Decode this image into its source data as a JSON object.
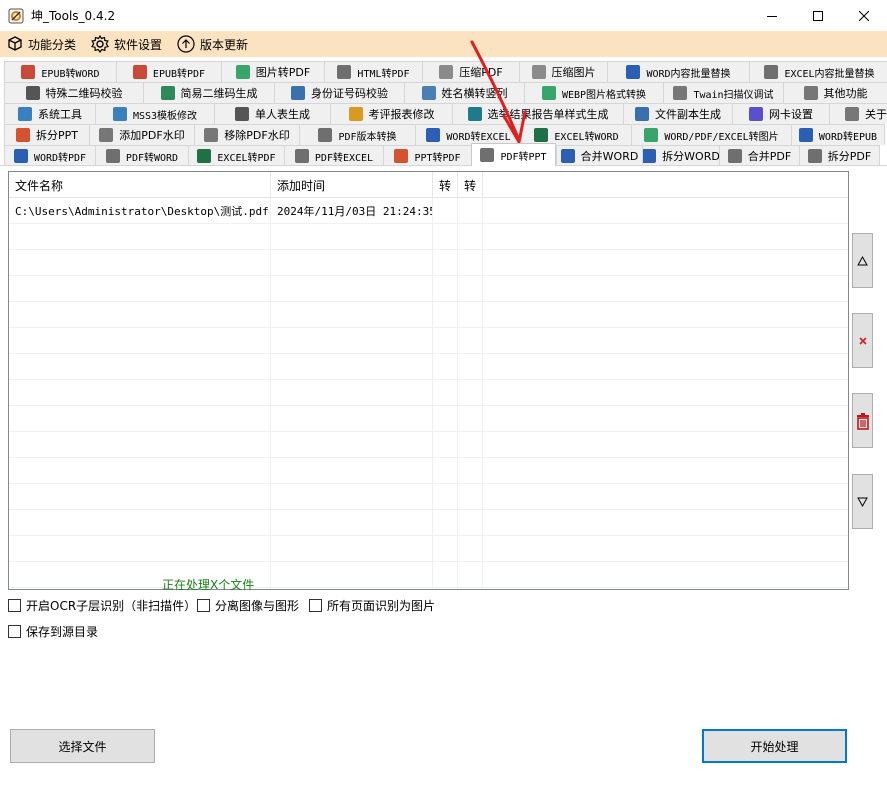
{
  "window": {
    "title": "坤_Tools_0.4.2",
    "controls": [
      "minimize",
      "maximize",
      "close"
    ]
  },
  "menubar": {
    "items": [
      {
        "label": "功能分类",
        "icon": "cube-icon"
      },
      {
        "label": "软件设置",
        "icon": "gear-icon"
      },
      {
        "label": "版本更新",
        "icon": "update-arrow-icon"
      }
    ]
  },
  "tab_rows": [
    [
      {
        "label": "EPUB转WORD",
        "icon": "pdf-file-icon",
        "color": "#c94a3a"
      },
      {
        "label": "EPUB转PDF",
        "icon": "pdf-file-icon",
        "color": "#c94a3a"
      },
      {
        "label": "图片转PDF",
        "icon": "image-icon",
        "color": "#3aa56b"
      },
      {
        "label": "HTML转PDF",
        "icon": "html-icon",
        "color": "#6f6f6f"
      },
      {
        "label": "压缩PDF",
        "icon": "compress-icon",
        "color": "#8a8a8a"
      },
      {
        "label": "压缩图片",
        "icon": "compress-icon",
        "color": "#8a8a8a"
      },
      {
        "label": "WORD内容批量替换",
        "icon": "word-icon",
        "color": "#2b5fb4"
      },
      {
        "label": "EXCEL内容批量替换",
        "icon": "excel-icon",
        "color": "#6f6f6f"
      }
    ],
    [
      {
        "label": "特殊二维码校验",
        "icon": "qr-icon",
        "color": "#555555"
      },
      {
        "label": "简易二维码生成",
        "icon": "qr-icon",
        "color": "#2e8b57"
      },
      {
        "label": "身份证号码校验",
        "icon": "id-card-icon",
        "color": "#3a6fb0"
      },
      {
        "label": "姓名横转竖列",
        "icon": "transform-icon",
        "color": "#4a7fb5"
      },
      {
        "label": "WEBP图片格式转换",
        "icon": "image-icon",
        "color": "#3aa56b"
      },
      {
        "label": "Twain扫描仪调试",
        "icon": "scanner-icon",
        "color": "#777777"
      },
      {
        "label": "其他功能",
        "icon": "more-icon",
        "color": "#777777"
      }
    ],
    [
      {
        "label": "系统工具",
        "icon": "gear-icon",
        "color": "#3a7fc0"
      },
      {
        "label": "MSS3模板修改",
        "icon": "gear-icon",
        "color": "#3a7fc0"
      },
      {
        "label": "单人表生成",
        "icon": "document-icon",
        "color": "#555555"
      },
      {
        "label": "考评报表修改",
        "icon": "report-icon",
        "color": "#d89a20"
      },
      {
        "label": "选举结果报告单样式生成",
        "icon": "document-icon",
        "color": "#1f7a8c"
      },
      {
        "label": "文件副本生成",
        "icon": "copy-icon",
        "color": "#3a6fb0"
      },
      {
        "label": "网卡设置",
        "icon": "network-icon",
        "color": "#5a4fcf"
      },
      {
        "label": "关于软件",
        "icon": "info-icon",
        "color": "#777777"
      }
    ],
    [
      {
        "label": "拆分PPT",
        "icon": "ppt-icon",
        "color": "#d35230"
      },
      {
        "label": "添加PDF水印",
        "icon": "watermark-icon",
        "color": "#777777"
      },
      {
        "label": "移除PDF水印",
        "icon": "watermark-icon",
        "color": "#777777"
      },
      {
        "label": "PDF版本转换",
        "icon": "pdf-file-icon",
        "color": "#6f6f6f"
      },
      {
        "label": "WORD转EXCEL",
        "icon": "word-icon",
        "color": "#2b5fb4"
      },
      {
        "label": "EXCEL转WORD",
        "icon": "excel-icon",
        "color": "#1e7145"
      },
      {
        "label": "WORD/PDF/EXCEL转图片",
        "icon": "image-icon",
        "color": "#3aa56b"
      },
      {
        "label": "WORD转EPUB",
        "icon": "word-icon",
        "color": "#2b5fb4"
      }
    ],
    [
      {
        "label": "WORD转PDF",
        "icon": "word-icon",
        "color": "#2b5fb4"
      },
      {
        "label": "PDF转WORD",
        "icon": "pdf-file-icon",
        "color": "#6f6f6f"
      },
      {
        "label": "EXCEL转PDF",
        "icon": "excel-icon",
        "color": "#1e7145"
      },
      {
        "label": "PDF转EXCEL",
        "icon": "pdf-file-icon",
        "color": "#6f6f6f"
      },
      {
        "label": "PPT转PDF",
        "icon": "ppt-icon",
        "color": "#d35230"
      },
      {
        "label": "PDF转PPT",
        "icon": "pdf-file-icon",
        "color": "#6f6f6f",
        "active": true
      },
      {
        "label": "合并WORD",
        "icon": "word-icon",
        "color": "#2b5fb4"
      },
      {
        "label": "拆分WORD",
        "icon": "word-icon",
        "color": "#2b5fb4"
      },
      {
        "label": "合并PDF",
        "icon": "pdf-file-icon",
        "color": "#6f6f6f"
      },
      {
        "label": "拆分PDF",
        "icon": "pdf-file-icon",
        "color": "#6f6f6f"
      }
    ]
  ],
  "file_list": {
    "columns": [
      "文件名称",
      "添加时间",
      "转",
      "转"
    ],
    "rows": [
      [
        "C:\\Users\\Administrator\\Desktop\\测试.pdf",
        "2024年/11月/03日 21:24:35",
        "",
        ""
      ]
    ]
  },
  "side_buttons": [
    {
      "label": "△",
      "name": "move-up-button"
    },
    {
      "label": "x",
      "name": "remove-button"
    },
    {
      "label": "clear",
      "name": "clear-list-button"
    },
    {
      "label": "▽",
      "name": "move-down-button"
    }
  ],
  "options": {
    "ocr_label": "开启OCR子层识别（非扫描件）",
    "separate_label": "分离图像与图形",
    "all_pages_label": "所有页面识别为图片",
    "save_to_source_label": "保存到源目录"
  },
  "actions": {
    "select_files_label": "选择文件",
    "status_text": "正在处理X个文件",
    "start_label": "开始处理"
  },
  "colors": {
    "menubar_bg": "#fbe2c0",
    "status_green": "#1a7f1a",
    "annotation_red": "#e02020",
    "primary_border": "#0078d7"
  }
}
